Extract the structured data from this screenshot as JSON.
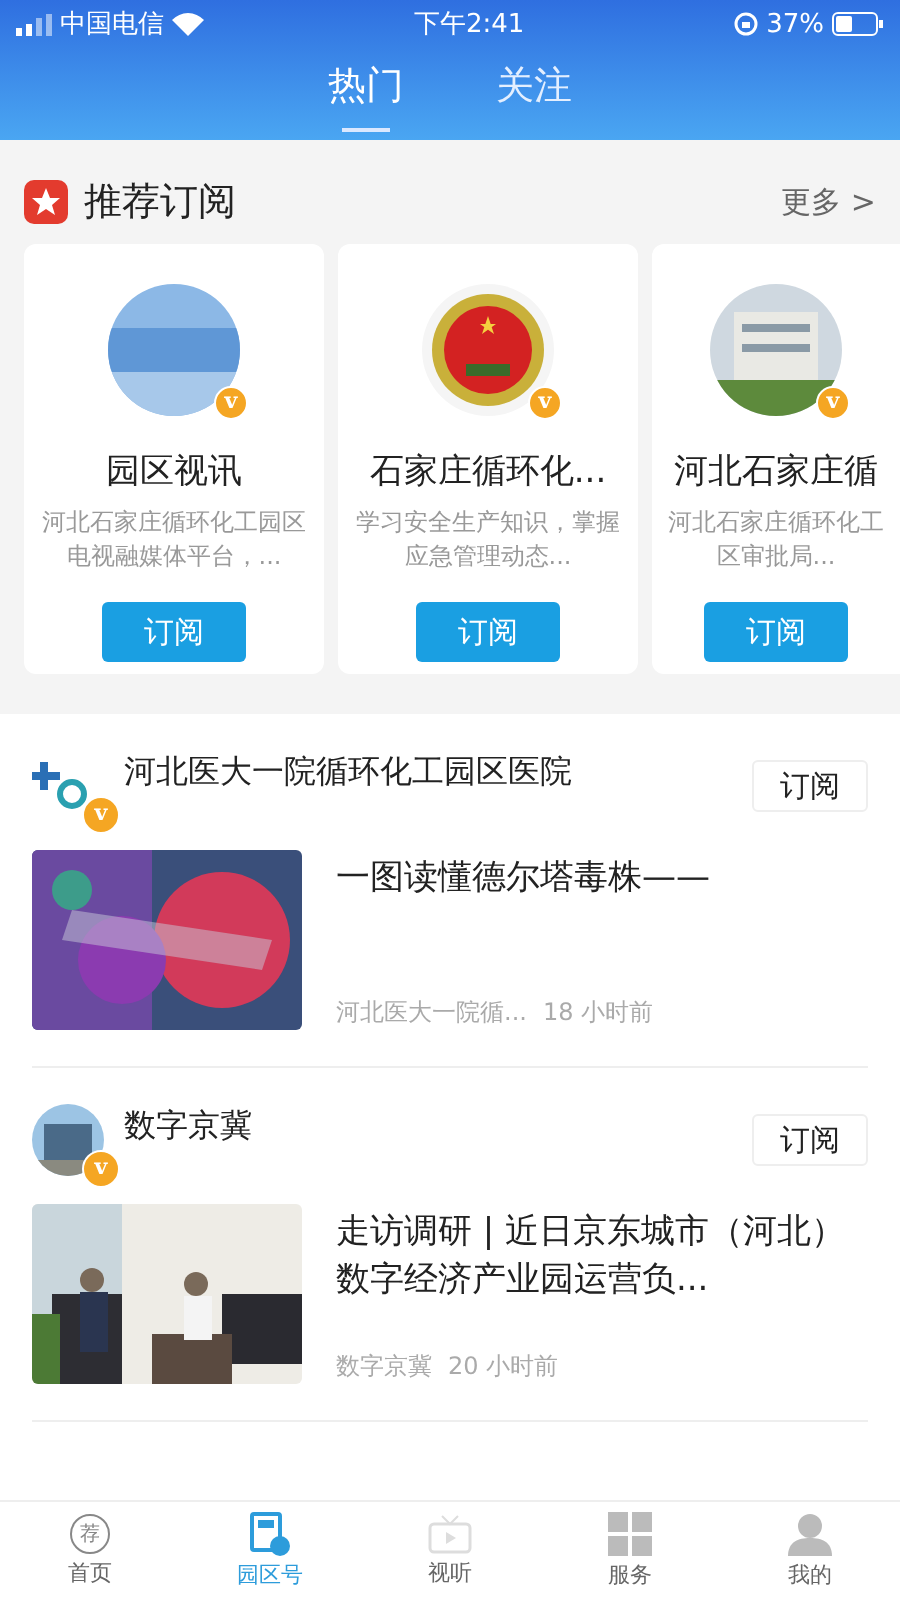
{
  "status_bar": {
    "carrier": "中国电信",
    "time": "下午2:41",
    "battery": "37%"
  },
  "top_tabs": [
    {
      "label": "热门",
      "selected": true
    },
    {
      "label": "关注",
      "selected": false
    }
  ],
  "recommend": {
    "title": "推荐订阅",
    "more": "更多 >",
    "cards": [
      {
        "name": "园区视讯",
        "description": "河北石家庄循环化工园区电视融媒体平台，...",
        "button": "订阅",
        "avatar": {
          "verified": true,
          "badge": "v"
        }
      },
      {
        "name": "石家庄循环化...",
        "description": "学习安全生产知识，掌握应急管理动态...",
        "button": "订阅",
        "avatar": {
          "verified": true,
          "badge": "v"
        }
      },
      {
        "name": "河北石家庄循",
        "description": "河北石家庄循环化工区审批局...",
        "button": "订阅",
        "avatar": {
          "verified": true,
          "badge": "v"
        }
      }
    ]
  },
  "feed": [
    {
      "account": "河北医大一院循环化工园区医院",
      "verified": true,
      "badge": "v",
      "button": "订阅",
      "article": {
        "title": "一图读懂德尔塔毒株——",
        "source": "河北医大一院循...",
        "time": "18 小时前"
      }
    },
    {
      "account": "数字京冀",
      "verified": true,
      "badge": "v",
      "button": "订阅",
      "article": {
        "title": "走访调研 | 近日京东城市（河北）数字经济产业园运营负...",
        "source": "数字京冀",
        "time": "20 小时前"
      }
    }
  ],
  "bottom_tabs": [
    {
      "label": "首页",
      "icon_text": "荐",
      "selected": false,
      "kind": "home"
    },
    {
      "label": "园区号",
      "selected": true,
      "kind": "park"
    },
    {
      "label": "视听",
      "selected": false,
      "kind": "tv"
    },
    {
      "label": "服务",
      "selected": false,
      "kind": "grid"
    },
    {
      "label": "我的",
      "selected": false,
      "kind": "person"
    }
  ]
}
